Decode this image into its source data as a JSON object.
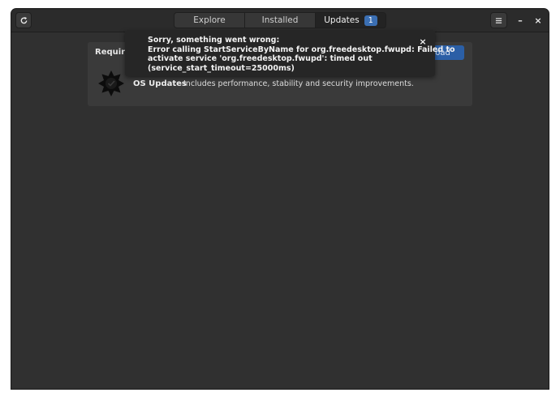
{
  "headerbar": {
    "refresh_icon": "refresh-icon",
    "tabs": [
      {
        "label": "Explore"
      },
      {
        "label": "Installed"
      },
      {
        "label": "Updates",
        "badge": "1"
      }
    ],
    "menu_icon": "hamburger-menu-icon",
    "minimize_label": "–",
    "close_label": "×"
  },
  "updates": {
    "section_header": "Requires Restart",
    "download_label": "Download",
    "items": [
      {
        "title": "OS Updates",
        "description": "Includes performance, stability and security improvements.",
        "icon": "os-updates-icon"
      }
    ]
  },
  "notification": {
    "lines": [
      "Sorry, something went wrong:",
      "Error calling StartServiceByName for org.freedesktop.fwupd: Failed to",
      "activate service 'org.freedesktop.fwupd': timed out",
      "(service_start_timeout=25000ms)"
    ],
    "close_label": "×"
  },
  "colors": {
    "window_bg": "#303030",
    "headerbar_bg": "#2b2b2b",
    "accent": "#3b6fb3",
    "card_bg": "#3a3a3a",
    "toast_bg": "#262626"
  }
}
